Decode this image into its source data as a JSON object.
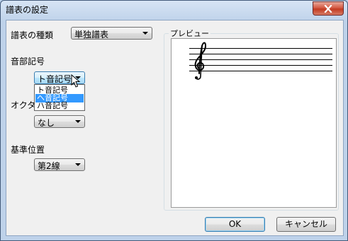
{
  "window": {
    "title": "譜表の設定"
  },
  "staff_type": {
    "label": "譜表の種類",
    "value": "単独譜表"
  },
  "clef": {
    "label": "音部記号",
    "value": "ト音記号",
    "options": [
      "ト音記号",
      "ヘ音記号",
      "ハ音記号"
    ],
    "highlighted_option": "ヘ音記号"
  },
  "octave": {
    "label": "オクター",
    "value": "なし"
  },
  "reference_position": {
    "label": "基準位置",
    "value": "第2線"
  },
  "preview": {
    "title": "プレビュー",
    "clef_symbol": "𝄞"
  },
  "buttons": {
    "ok": "OK",
    "cancel": "キャンセル"
  },
  "icons": {
    "close": "close-icon",
    "dropdown": "chevron-down-icon",
    "cursor": "mouse-pointer-icon"
  }
}
